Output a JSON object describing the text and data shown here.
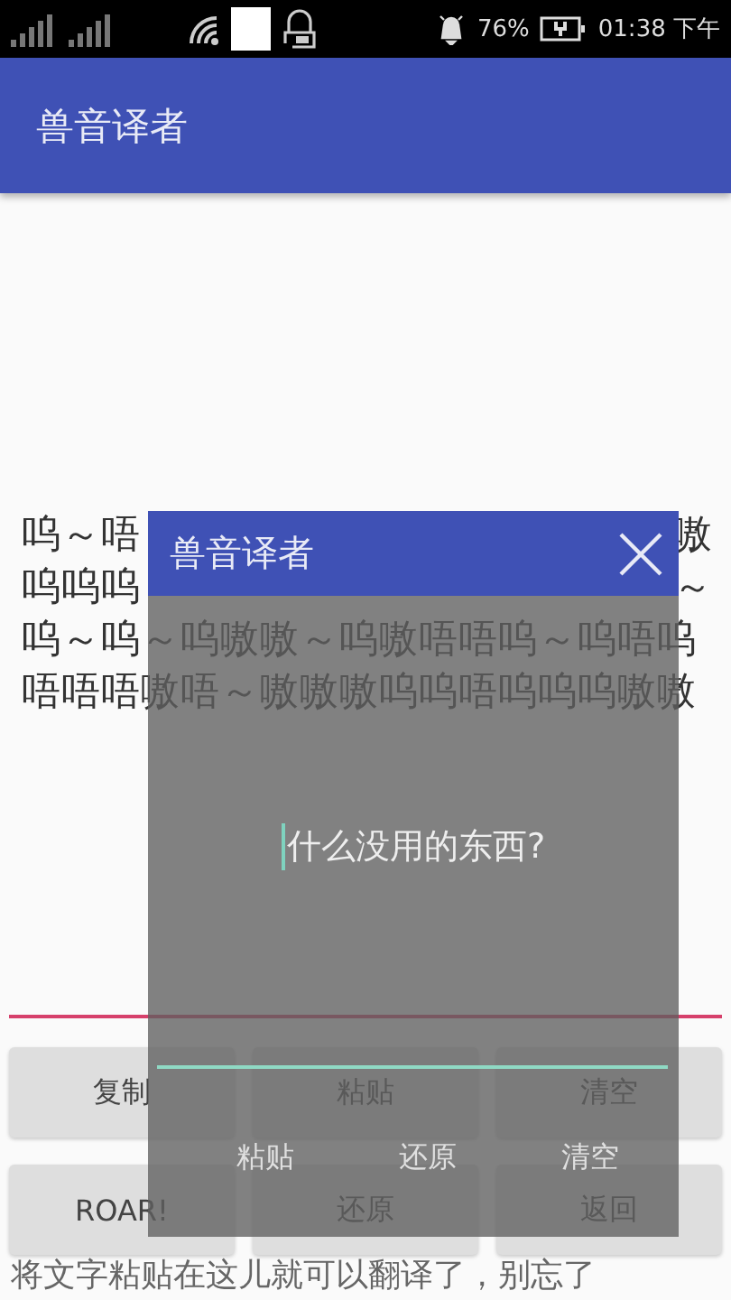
{
  "status_bar": {
    "battery": "76%",
    "time": "01:38 下午"
  },
  "app_bar": {
    "title": "兽音译者"
  },
  "output_lines": [
    [
      "呜～唔",
      "嗷"
    ],
    [
      "呜呜呜",
      "～"
    ],
    [
      "呜～呜～呜嗷嗷～呜嗷唔唔呜～呜唔呜"
    ],
    [
      "唔唔唔嗷唔～嗷嗷嗷呜呜唔呜呜呜嗷嗷"
    ]
  ],
  "buttons": [
    {
      "label": "复制"
    },
    {
      "label": "粘贴"
    },
    {
      "label": "清空"
    },
    {
      "label": "ROAR!"
    },
    {
      "label": "还原"
    },
    {
      "label": "返回"
    }
  ],
  "hint": "将文字粘贴在这儿就可以翻译了，别忘了",
  "dialog": {
    "title": "兽音译者",
    "message": "什么没用的东西?",
    "buttons": [
      "粘贴",
      "还原",
      "清空"
    ]
  }
}
